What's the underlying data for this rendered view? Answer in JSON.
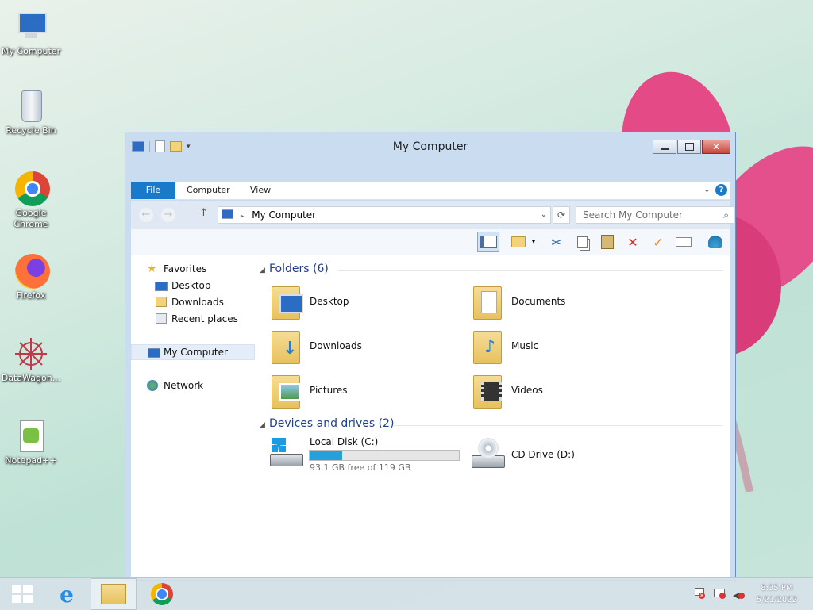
{
  "desktop": {
    "icons": [
      {
        "label": "My Computer",
        "icon": "computer-icon"
      },
      {
        "label": "Recycle Bin",
        "icon": "recycle-bin-icon"
      },
      {
        "label": "Google Chrome",
        "icon": "chrome-icon"
      },
      {
        "label": "Firefox",
        "icon": "firefox-icon"
      },
      {
        "label": "DataWagon...",
        "icon": "datawagon-icon"
      },
      {
        "label": "Notepad++",
        "icon": "notepad-plus-plus-icon"
      }
    ]
  },
  "window": {
    "title": "My Computer",
    "ribbon_tabs": [
      "File",
      "Computer",
      "View"
    ],
    "address": "My Computer",
    "search_placeholder": "Search My Computer",
    "nav": {
      "favorites": "Favorites",
      "desktop": "Desktop",
      "downloads": "Downloads",
      "recent": "Recent places",
      "computer": "My Computer",
      "network": "Network"
    },
    "folders_header": "Folders (6)",
    "folders": [
      {
        "label": "Desktop",
        "icon": "desktop-folder-icon"
      },
      {
        "label": "Documents",
        "icon": "documents-folder-icon"
      },
      {
        "label": "Downloads",
        "icon": "downloads-folder-icon"
      },
      {
        "label": "Music",
        "icon": "music-folder-icon"
      },
      {
        "label": "Pictures",
        "icon": "pictures-folder-icon"
      },
      {
        "label": "Videos",
        "icon": "videos-folder-icon"
      }
    ],
    "drives_header": "Devices and drives (2)",
    "drives": [
      {
        "label": "Local Disk (C:)",
        "free_text": "93.1 GB free of 119 GB",
        "used_fraction": 0.22,
        "icon": "hard-disk-icon"
      },
      {
        "label": "CD Drive (D:)",
        "icon": "cd-drive-icon"
      }
    ]
  },
  "taskbar": {
    "time": "8:35 PM",
    "date": "5/21/2022"
  },
  "colors": {
    "accent": "#1979ca",
    "group_header": "#1e3f8a",
    "drive_bar": "#26a0da"
  }
}
